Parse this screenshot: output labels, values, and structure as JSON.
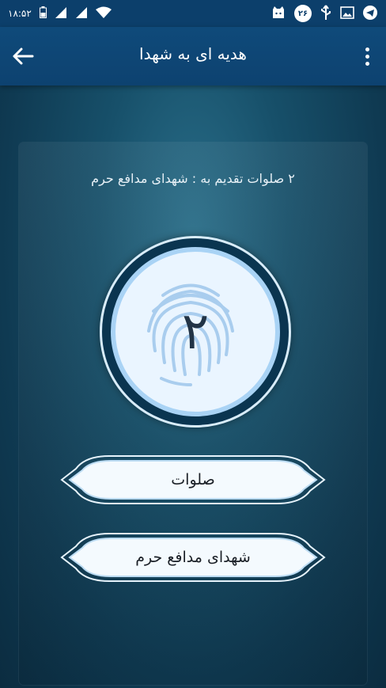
{
  "status_bar": {
    "time": "۱۸:۵۲",
    "notification_count": "۲۶"
  },
  "app_bar": {
    "title": "هدیه ای به شهدا"
  },
  "main": {
    "caption": "۲ صلوات تقدیم به : شهدای مدافع حرم",
    "counter_value": "۲",
    "buttons": [
      {
        "label": "صلوات"
      },
      {
        "label": "شهدای مدافع حرم"
      }
    ]
  }
}
